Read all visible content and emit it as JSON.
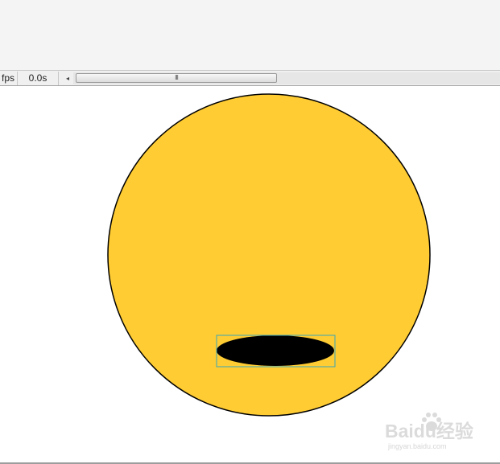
{
  "timeline": {
    "fps_label": "fps",
    "current_time": "0.0s",
    "scroll_left_glyph": "◂",
    "thumb_grip_glyph": "III"
  },
  "stage": {
    "background": "#ffffff",
    "face_color": "#ffcc33",
    "face_stroke": "#000000",
    "mouth_color": "#000000",
    "selection_color": "#3aa6b9"
  },
  "watermark": {
    "brand": "Baidu经验",
    "url": "jingyan.baidu.com"
  },
  "icons": {
    "scroll_left": "triangle-left-icon",
    "paw": "paw-icon"
  }
}
